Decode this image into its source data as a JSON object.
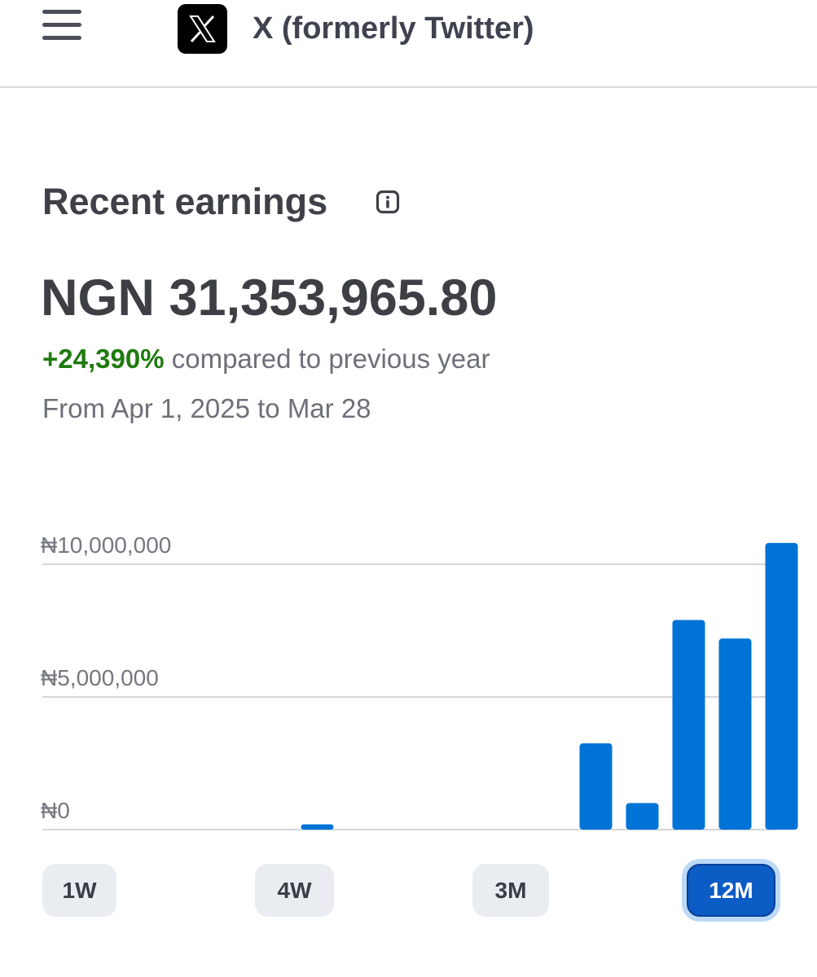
{
  "header": {
    "menu_icon": "hamburger-menu-icon",
    "logo_icon": "x-logo-icon",
    "title": "X (formerly Twitter)"
  },
  "earnings": {
    "title": "Recent earnings",
    "info_icon": "info-icon",
    "amount": "NGN 31,353,965.80",
    "change_pct": "+24,390%",
    "change_text": " compared to previous year",
    "date_range": "From Apr 1, 2025 to Mar 28",
    "positive_color": "#1f7a0f"
  },
  "chart_data": {
    "type": "bar",
    "currency_symbol": "₦",
    "y_ticks": [
      "₦10,000,000",
      "₦5,000,000",
      "₦0"
    ],
    "y_tick_values": [
      10000000,
      5000000,
      0
    ],
    "ylim": [
      0,
      10000000
    ],
    "grid": true,
    "bar_color": "#0073d6",
    "values": [
      0,
      0,
      0,
      200000,
      0,
      0,
      0,
      0,
      0,
      3250000,
      1000000,
      7900000,
      7200000,
      10800000
    ]
  },
  "ranges": {
    "items": [
      "1W",
      "4W",
      "3M",
      "12M"
    ],
    "selected": "12M"
  }
}
